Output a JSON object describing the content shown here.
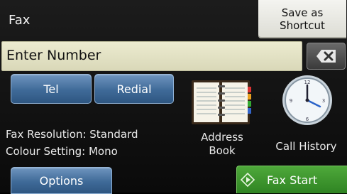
{
  "screen": {
    "title": "Fax",
    "shortcut_button": {
      "line1": "Save as",
      "line2": "Shortcut"
    },
    "number_field": {
      "text": "Enter Number"
    },
    "backspace_icon": "backspace-icon",
    "buttons": {
      "tel": "Tel",
      "redial": "Redial",
      "options": "Options",
      "fax_start": "Fax Start"
    },
    "status": {
      "fax_resolution": "Fax Resolution: Standard",
      "colour_setting": "Colour Setting: Mono"
    },
    "address_book": {
      "line1": "Address",
      "line2": "Book",
      "icon": "address-book-icon"
    },
    "call_history": {
      "label": "Call History",
      "icon": "clock-icon"
    },
    "colors": {
      "blue_button": "#3f6a98",
      "green_button": "#2f8423",
      "field": "#e6e5c8"
    }
  }
}
